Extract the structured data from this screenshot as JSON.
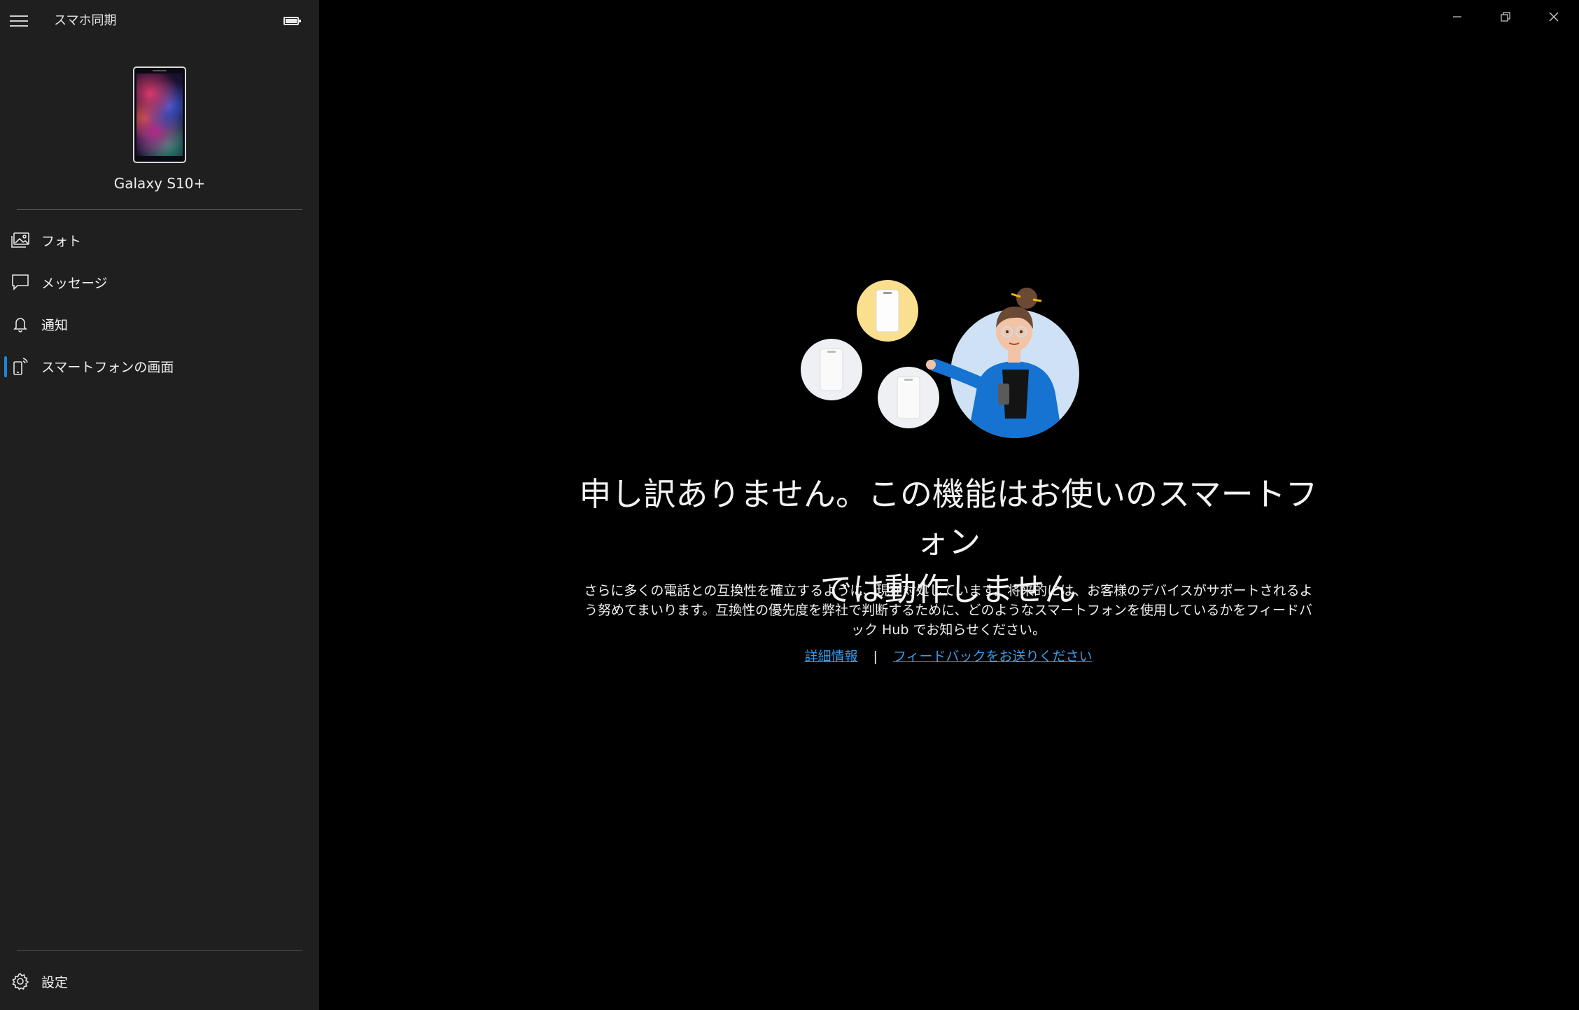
{
  "app": {
    "title": "スマホ同期"
  },
  "device": {
    "name": "Galaxy S10+"
  },
  "sidebar": {
    "items": [
      {
        "label": "フォト",
        "icon": "photo-icon"
      },
      {
        "label": "メッセージ",
        "icon": "message-icon"
      },
      {
        "label": "通知",
        "icon": "bell-icon"
      },
      {
        "label": "スマートフォンの画面",
        "icon": "phone-screen-icon",
        "selected": true
      }
    ],
    "settings_label": "設定"
  },
  "main": {
    "headline_line1": "申し訳ありません。この機能はお使いのスマートフォン",
    "headline_line2": "では動作しません",
    "body": "さらに多くの電話との互換性を確立するように、現在対処しています。将来的には、お客様のデバイスがサポートされるよう努めてまいります。互換性の優先度を弊社で判断するために、どのようなスマートフォンを使用しているかをフィードバック Hub でお知らせください。",
    "link_details": "詳細情報",
    "link_separator": "|",
    "link_feedback": "フィードバックをお送りください"
  },
  "colors": {
    "accent": "#1a86e0",
    "link": "#3a9bea",
    "sidebar_bg": "#1f1f1f",
    "main_bg": "#000000"
  }
}
